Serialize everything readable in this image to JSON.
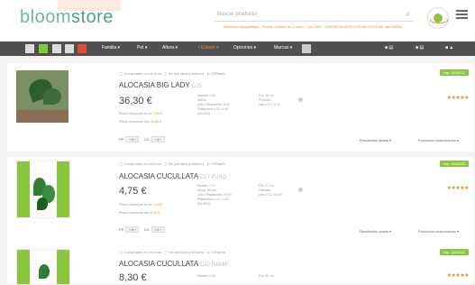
{
  "header": {
    "logo_part1": "bloom",
    "logo_part2": "store",
    "search_placeholder": "Buscar producto",
    "notice": "Selección fotografiada · Pedido mínimo de 1 carro · 1 jul 2021 · ENTREGA GRATUITA EN RUTA DE VALENCIA"
  },
  "toolbar": {
    "menu": [
      {
        "label": "Familia ▾",
        "orange": false
      },
      {
        "label": "Pot ▾",
        "orange": false
      },
      {
        "label": "Altura ▾",
        "orange": false
      },
      {
        "label": "• Estado ▾",
        "orange": true
      },
      {
        "label": "Opciones ▾",
        "orange": false
      },
      {
        "label": "Marcas ▾",
        "orange": false
      }
    ],
    "right_items": [
      "■ ▤",
      "■ ▤",
      "■ ▲"
    ]
  },
  "products": [
    {
      "meta": "Compradas en mi zona",
      "meta2": "De (vendyst premium)",
      "meta3": "CSPlants",
      "name": "ALOCASIA BIG LADY",
      "sub": "C25",
      "price": "36,30 €",
      "line1_label": "Precio transporte en ud: ",
      "line1_value": "7,50 €",
      "line2_label": "Precio transporte mín: ",
      "line2_value": "43,80 €",
      "specs": [
        "Maceta: C25",
        "Altura: ",
        "Uds x Plataforma: 8.00",
        "Plataforma x CC: 1.90",
        "(50.00%)"
      ],
      "specs2": [
        "Pot: 25 cm",
        "Formato: ",
        "Uds x CC: 8.00"
      ],
      "qty_label": "PP",
      "qty_value": "0",
      "cc_label": "CC",
      "cc_value": "0",
      "tag": "Imp. 16/06/22",
      "stars": "★★★★★",
      "dd1": "Resultados dados ▾",
      "dd2": "Productos relacionados ▾"
    },
    {
      "meta": "Compradas en mi zona",
      "meta2": "De (vendyst premium)",
      "meta3": "CSPlants",
      "name": "ALOCASIA CUCULLATA",
      "sub": "C17 FUSO",
      "price": "4,75 €",
      "line1_label": "Precio transporte en ud: ",
      "line1_value": "1,24 €",
      "line2_label": "Precio transporte mín: ",
      "line2_value": "6,09 €",
      "specs": [
        "Maceta: C17",
        "Altura: 50 cm",
        "Uds x Plataforma: 20.00",
        "Plataforma x CC: 3.50",
        "(50.00%)"
      ],
      "specs2": [
        "Pot: 17 cm",
        "Formato: ",
        "Uds x CC: 90.00"
      ],
      "qty_label": "PP",
      "qty_value": "0",
      "cc_label": "CC",
      "cc_value": "0",
      "tag": "Imp. 16/06/22",
      "stars": "★★★★★",
      "dd1": "Resultados dados ▾",
      "dd2": "Productos relacionados ▾"
    },
    {
      "meta": "Compradas en mi zona",
      "meta2": "De (vendyst premium)",
      "meta3": "CSPlants",
      "name": "ALOCASIA CUCULLATA",
      "sub": "C20 RAMIF",
      "price": "8,30 €",
      "specs": [
        "Maceta: C20"
      ],
      "specs2": [
        "Pot: 20 cm"
      ],
      "tag": "Imp. 16/06/22",
      "stars": "★★★★★"
    }
  ]
}
